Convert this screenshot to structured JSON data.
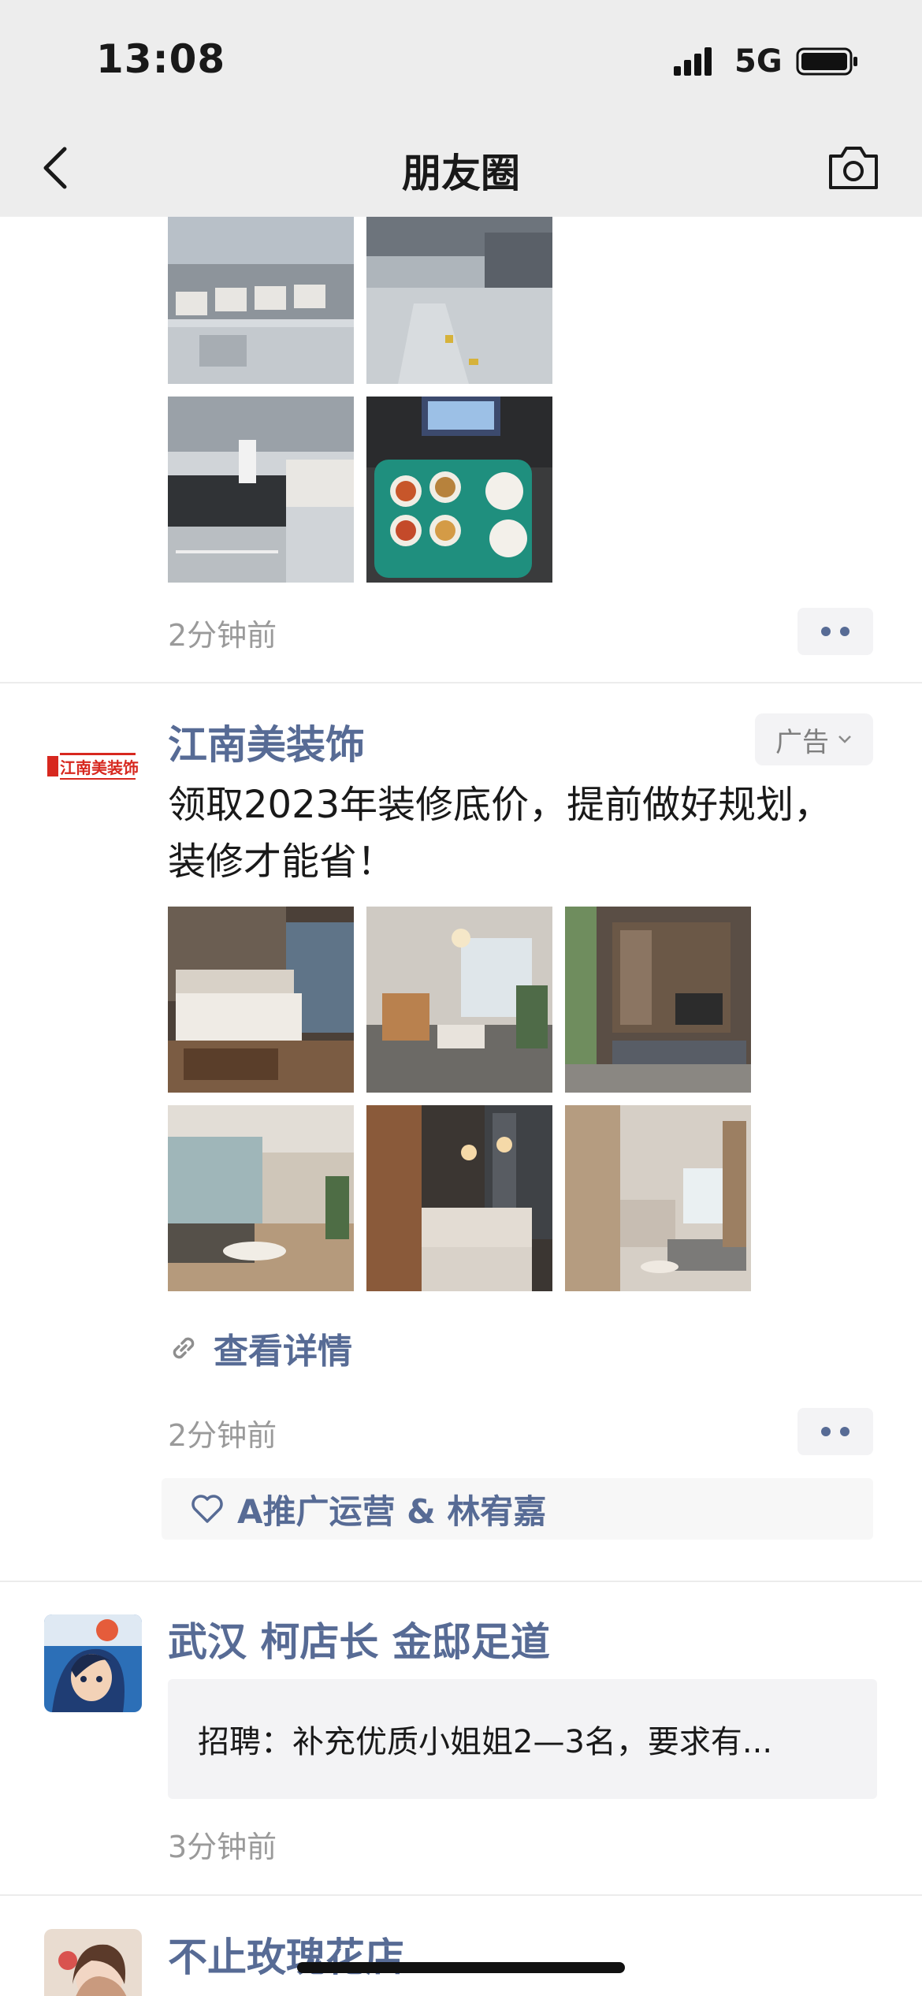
{
  "status_bar": {
    "time": "13:08",
    "network": "5G"
  },
  "nav": {
    "title": "朋友圈",
    "back_icon": "chevron-left-icon",
    "camera_icon": "camera-icon"
  },
  "colors": {
    "link_blue": "#576b95",
    "header_bg": "#ededed",
    "secondary_text": "#9a9a9a",
    "brand_red": "#d7281f"
  },
  "post1": {
    "timestamp": "2分钟前",
    "photos": [
      "cafeteria-dining-hall",
      "cafeteria-serving-line",
      "cafeteria-counter",
      "meal-tray"
    ]
  },
  "post2": {
    "nickname": "江南美装饰",
    "avatar_logo": "江南美装饰",
    "ad_label": "广告",
    "text": "领取2023年装修底价，提前做好规划，装修才能省！",
    "photos": [
      "bedroom",
      "dining-living-room",
      "living-room-bookshelf",
      "sunlit-living-room",
      "kitchen-island",
      "compact-living-room"
    ],
    "link_label": "查看详情",
    "timestamp": "2分钟前",
    "likes": "A推广运营 & 林宥嘉"
  },
  "post3": {
    "nickname": "武汉 柯店长 金邸足道",
    "share_text": "招聘：补充优质小姐姐2—3名，要求有...",
    "timestamp": "3分钟前"
  },
  "post4": {
    "nickname": "不止玫瑰花店"
  }
}
